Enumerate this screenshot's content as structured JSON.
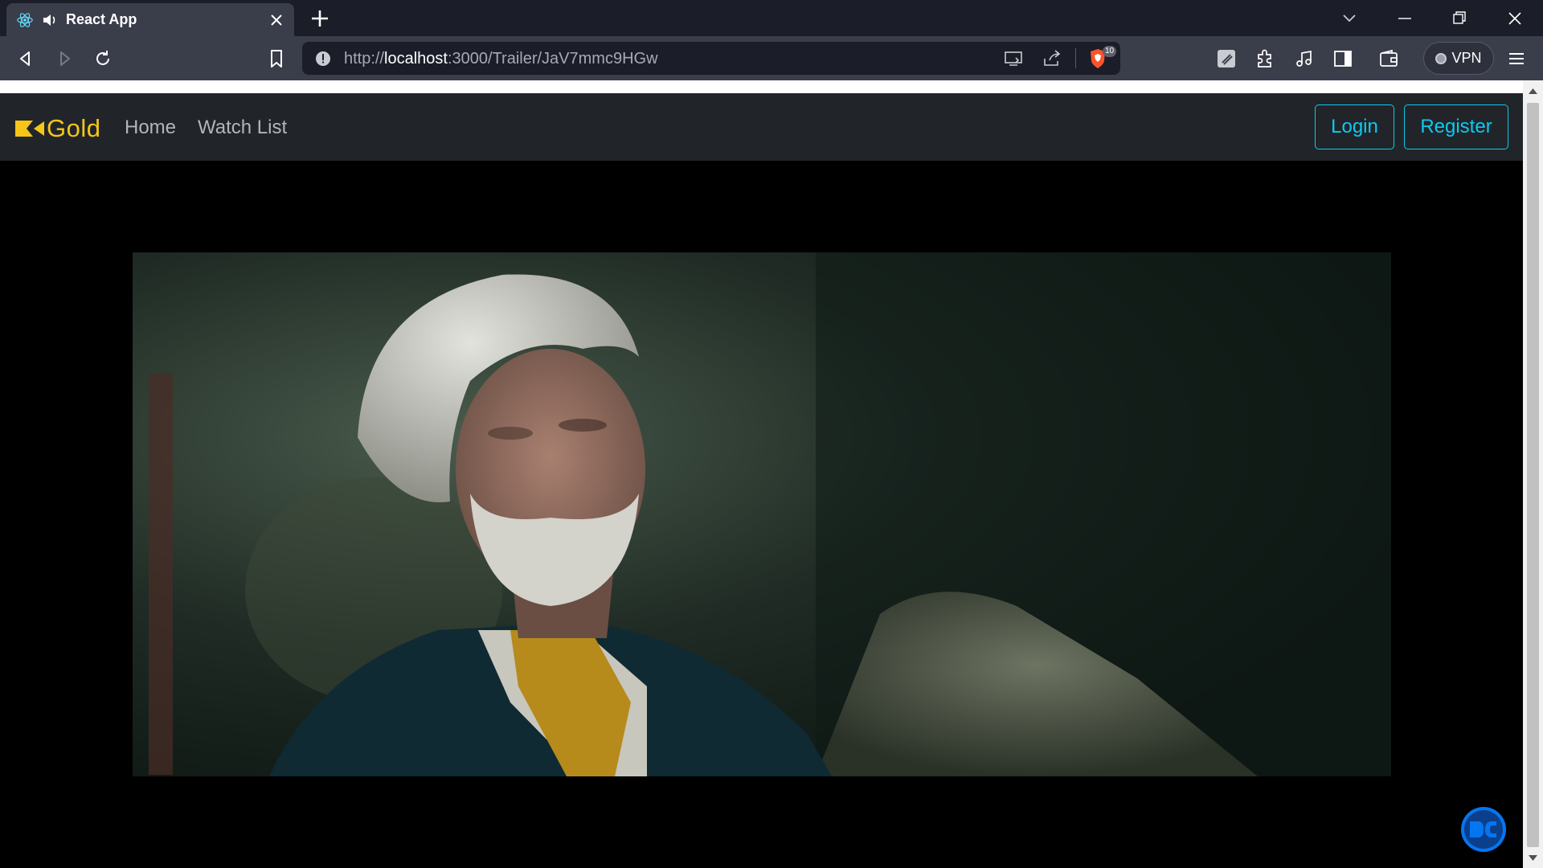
{
  "browser": {
    "tab": {
      "title": "React App"
    },
    "url": {
      "scheme": "http://",
      "host": "localhost",
      "rest": ":3000/Trailer/JaV7mmc9HGw"
    },
    "shield_count": "10",
    "vpn_label": "VPN"
  },
  "app": {
    "logo_text": "Gold",
    "nav": {
      "home": "Home",
      "watchlist": "Watch List"
    },
    "auth": {
      "login": "Login",
      "register": "Register"
    },
    "colors": {
      "navbar_bg": "#212529",
      "brand": "#f5c518",
      "outline": "#0dcaf0",
      "nav_text": "#b3b5b8"
    }
  },
  "video": {
    "watermark_icon": "dc-logo-icon"
  }
}
